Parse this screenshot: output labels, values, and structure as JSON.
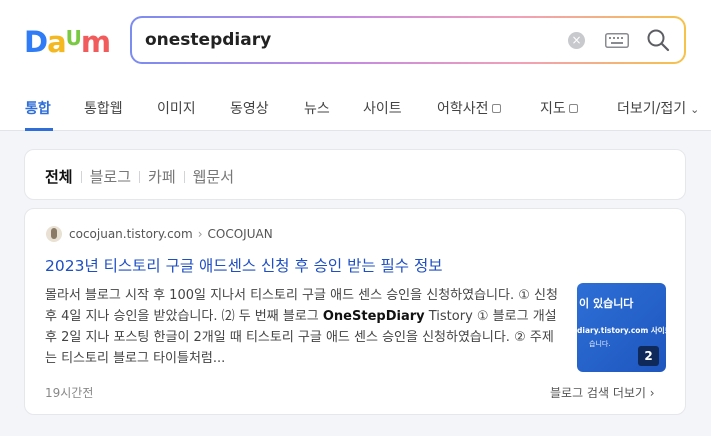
{
  "logo": {
    "text": "Daum",
    "letters": [
      "D",
      "a",
      "U",
      "m"
    ],
    "colors": [
      "#2f7cf6",
      "#f4b921",
      "#7ac943",
      "#f25b5b"
    ]
  },
  "search": {
    "value": "onestepdiary"
  },
  "tabs": [
    {
      "label": "통합",
      "active": true
    },
    {
      "label": "통합웹"
    },
    {
      "label": "이미지"
    },
    {
      "label": "동영상"
    },
    {
      "label": "뉴스"
    },
    {
      "label": "사이트"
    },
    {
      "label": "어학사전",
      "external": true
    },
    {
      "label": "지도",
      "external": true
    },
    {
      "label": "더보기/접기",
      "dropdown": true
    }
  ],
  "filters": [
    "전체",
    "블로그",
    "카페",
    "웹문서"
  ],
  "result": {
    "domain": "cocojuan.tistory.com",
    "author": "COCOJUAN",
    "title": "2023년 티스토리 구글 애드센스 신청 후 승인 받는 필수 정보",
    "snippet": {
      "before": "몰라서 블로그 시작 후 100일 지나서 티스토리 구글 애드 센스 승인을 신청하였습니다. ① 신청 후 4일 지나 승인을 받았습니다. ⑵ 두 번째 블로그 ",
      "highlight": "OneStepDiary",
      "after": " Tistory ① 블로그 개설 후 2일 지나 포스팅 한글이 2개일 때 티스토리 구글 애드 센스 승인을 신청하였습니다. ② 주제는 티스토리 블로그 타이틀처럼..."
    },
    "thumbnail": {
      "line1": "이 있습니다",
      "line2": "diary.tistory.com 사이트",
      "line3": "습니다.",
      "count": "2"
    },
    "time": "19시간전",
    "more": "블로그 검색 더보기"
  },
  "accent": "#2f6ed8"
}
